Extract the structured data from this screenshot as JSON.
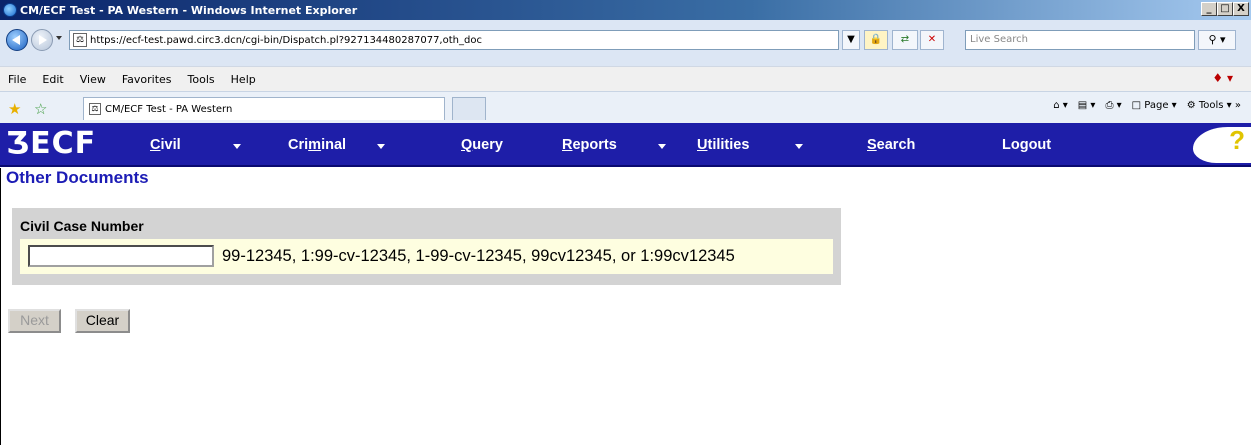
{
  "window": {
    "title": "CM/ECF Test - PA Western - Windows Internet Explorer",
    "controls": [
      "_",
      "□",
      "X"
    ]
  },
  "address_bar": {
    "url": "https://ecf-test.pawd.circ3.dcn/cgi-bin/Dispatch.pl?927134480287077,oth_doc",
    "search_placeholder": "Live Search"
  },
  "menu": {
    "items": [
      "File",
      "Edit",
      "View",
      "Favorites",
      "Tools",
      "Help"
    ]
  },
  "tab": {
    "title": "CM/ECF Test - PA Western"
  },
  "command_bar": {
    "page_label": "Page",
    "tools_label": "Tools"
  },
  "ecf_nav": {
    "logo": "ƷECF",
    "items": [
      {
        "label": "Civil",
        "dropdown": true
      },
      {
        "label": "Criminal",
        "dropdown": true
      },
      {
        "label": "Query",
        "dropdown": false
      },
      {
        "label": "Reports",
        "dropdown": true
      },
      {
        "label": "Utilities",
        "dropdown": true
      },
      {
        "label": "Search",
        "dropdown": false
      },
      {
        "label": "Logout",
        "dropdown": false
      }
    ],
    "help": "?"
  },
  "page": {
    "title": "Other Documents",
    "form": {
      "label": "Civil Case Number",
      "value": "",
      "hint": "99-12345, 1:99-cv-12345, 1-99-cv-12345, 99cv12345, or 1:99cv12345"
    },
    "buttons": {
      "next": "Next",
      "clear": "Clear"
    }
  },
  "colors": {
    "ecf_bar": "#1e1ea8",
    "page_title": "#1c1cb5",
    "form_panel": "#d3d3d3",
    "input_row": "#fefee0"
  }
}
